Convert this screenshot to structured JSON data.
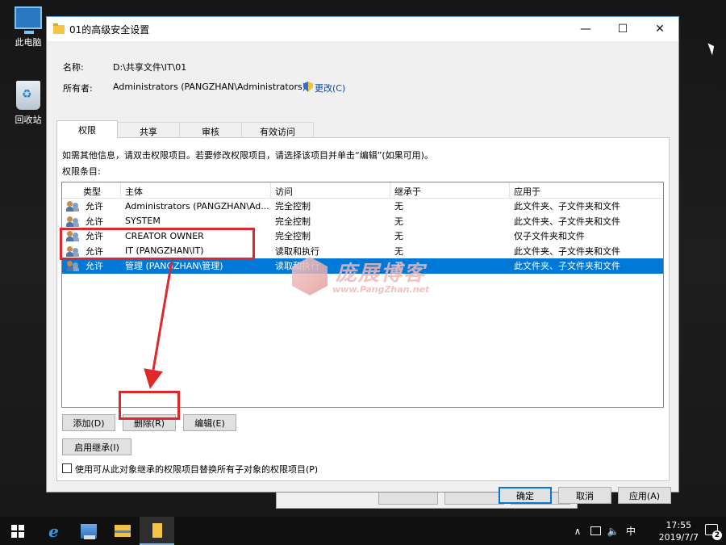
{
  "desktop": {
    "icons": [
      {
        "label": "此电脑"
      },
      {
        "label": "回收站"
      }
    ]
  },
  "window": {
    "title": "01的高级安全设置",
    "controls": {
      "minimize": "—",
      "maximize": "☐",
      "close": "✕"
    }
  },
  "info": {
    "name_label": "名称:",
    "name_value": "D:\\共享文件\\IT\\01",
    "owner_label": "所有者:",
    "owner_value": "Administrators (PANGZHAN\\Administrators)",
    "change_link": "更改(C)"
  },
  "tabs": [
    {
      "label": "权限",
      "active": true
    },
    {
      "label": "共享"
    },
    {
      "label": "审核"
    },
    {
      "label": "有效访问"
    }
  ],
  "permissions": {
    "instruction": "如需其他信息，请双击权限项目。若要修改权限项目，请选择该项目并单击“编辑”(如果可用)。",
    "entries_label": "权限条目:",
    "columns": [
      "类型",
      "主体",
      "访问",
      "继承于",
      "应用于"
    ],
    "rows": [
      {
        "type": "允许",
        "principal": "Administrators (PANGZHAN\\Ad...",
        "access": "完全控制",
        "inherited": "无",
        "applies": "此文件夹、子文件夹和文件"
      },
      {
        "type": "允许",
        "principal": "SYSTEM",
        "access": "完全控制",
        "inherited": "无",
        "applies": "此文件夹、子文件夹和文件"
      },
      {
        "type": "允许",
        "principal": "CREATOR OWNER",
        "access": "完全控制",
        "inherited": "无",
        "applies": "仅子文件夹和文件"
      },
      {
        "type": "允许",
        "principal": "IT (PANGZHAN\\IT)",
        "access": "读取和执行",
        "inherited": "无",
        "applies": "此文件夹、子文件夹和文件"
      },
      {
        "type": "允许",
        "principal": "管理 (PANGZHAN\\管理)",
        "access": "读取和执行",
        "inherited": "无",
        "applies": "此文件夹、子文件夹和文件",
        "selected": true
      }
    ],
    "add_button": "添加(D)",
    "remove_button": "删除(R)",
    "edit_button": "编辑(E)",
    "enable_inheritance_button": "启用继承(I)",
    "replace_checkbox_label": "使用可从此对象继承的权限项目替换所有子对象的权限项目(P)"
  },
  "footer": {
    "ok": "确定",
    "cancel": "取消",
    "apply": "应用(A)"
  },
  "watermark": {
    "text": "庞展博客",
    "url": "www.PangZhan.net"
  },
  "taskbar": {
    "tray_chevron": "∧",
    "ime": "中",
    "time": "17:55",
    "date": "2019/7/7",
    "notifications": "2"
  },
  "colors": {
    "selection": "#0078d7",
    "highlight_box": "#e0282a",
    "window_border": "#5a9bd5"
  }
}
